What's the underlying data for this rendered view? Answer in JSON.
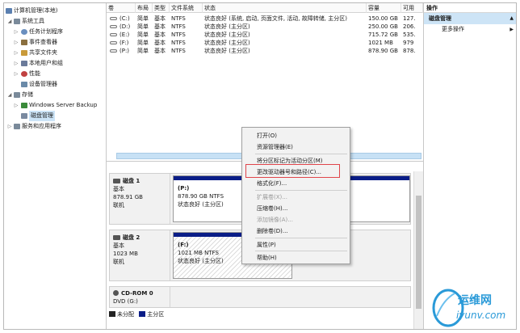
{
  "tree": {
    "items": [
      {
        "label": "计算机管理(本地)",
        "arrow": "",
        "color": "#5a7fb0"
      },
      {
        "label": "系统工具",
        "arrow": "◢",
        "color": "#7a8a9a"
      },
      {
        "label": "任务计划程序",
        "arrow": "▷",
        "color": "#6a8fbf"
      },
      {
        "label": "事件查看器",
        "arrow": "▷",
        "color": "#8a6f3f"
      },
      {
        "label": "共享文件夹",
        "arrow": "▷",
        "color": "#c99a3a"
      },
      {
        "label": "本地用户和组",
        "arrow": "▷",
        "color": "#6a7a9a"
      },
      {
        "label": "性能",
        "arrow": "▷",
        "color": "#c04040"
      },
      {
        "label": "设备管理器",
        "arrow": "",
        "color": "#6a8aa8"
      },
      {
        "label": "存储",
        "arrow": "◢",
        "color": "#7a8a9a"
      },
      {
        "label": "Windows Server Backup",
        "arrow": "▷",
        "color": "#3a8a3a"
      },
      {
        "label": "磁盘管理",
        "arrow": "",
        "color": "#7a8aa0"
      },
      {
        "label": "服务和应用程序",
        "arrow": "▷",
        "color": "#7a8a9a"
      }
    ]
  },
  "volumes": {
    "headers": [
      "卷",
      "布局",
      "类型",
      "文件系统",
      "状态",
      "容量",
      "可用"
    ],
    "rows": [
      [
        "(C:)",
        "简单",
        "基本",
        "NTFS",
        "状态良好 (系统, 启动, 页面文件, 活动, 故障转储, 主分区)",
        "150.00 GB",
        "127."
      ],
      [
        "(D:)",
        "简单",
        "基本",
        "NTFS",
        "状态良好 (主分区)",
        "250.00 GB",
        "206."
      ],
      [
        "(E:)",
        "简单",
        "基本",
        "NTFS",
        "状态良好 (主分区)",
        "715.72 GB",
        "535."
      ],
      [
        "(F:)",
        "简单",
        "基本",
        "NTFS",
        "状态良好 (主分区)",
        "1021 MB",
        "979"
      ],
      [
        "(P:)",
        "简单",
        "基本",
        "NTFS",
        "状态良好 (主分区)",
        "878.90 GB",
        "878."
      ]
    ]
  },
  "disks": [
    {
      "name": "磁盘 1",
      "type": "基本",
      "size": "878.91 GB",
      "status": "联机",
      "part": {
        "drive": "(P:)",
        "size": "878.90 GB NTFS",
        "status": "状态良好 (主分区)"
      }
    },
    {
      "name": "磁盘 2",
      "type": "基本",
      "size": "1023 MB",
      "status": "联机",
      "part": {
        "drive": "(F:)",
        "size": "1021 MB NTFS",
        "status": "状态良好 (主分区)"
      }
    },
    {
      "name": "CD-ROM 0",
      "type": "DVD (G:)",
      "size": "",
      "status": ""
    }
  ],
  "legend": {
    "unallocated": "未分配",
    "primary": "主分区"
  },
  "actions": {
    "title": "操作",
    "section": "磁盘管理",
    "items": [
      "更多操作"
    ]
  },
  "context_menu": {
    "items": [
      {
        "label": "打开(O)",
        "disabled": false
      },
      {
        "label": "资源管理器(E)",
        "disabled": false
      },
      {
        "label": "将分区标记为活动分区(M)",
        "disabled": false
      },
      {
        "label": "更改驱动器号和路径(C)...",
        "disabled": false
      },
      {
        "label": "格式化(F)...",
        "disabled": false
      },
      {
        "label": "扩展卷(X)...",
        "disabled": true
      },
      {
        "label": "压缩卷(H)...",
        "disabled": false
      },
      {
        "label": "添加镜像(A)...",
        "disabled": true
      },
      {
        "label": "删除卷(D)...",
        "disabled": false
      },
      {
        "label": "属性(P)",
        "disabled": false
      },
      {
        "label": "帮助(H)",
        "disabled": false
      }
    ]
  },
  "colors": {
    "primary_partition": "#0a1d87",
    "highlight_box": "#e0454b",
    "selection": "#cde4f6"
  },
  "watermark": {
    "line1": "运维网",
    "line2": "iyunv.com"
  }
}
